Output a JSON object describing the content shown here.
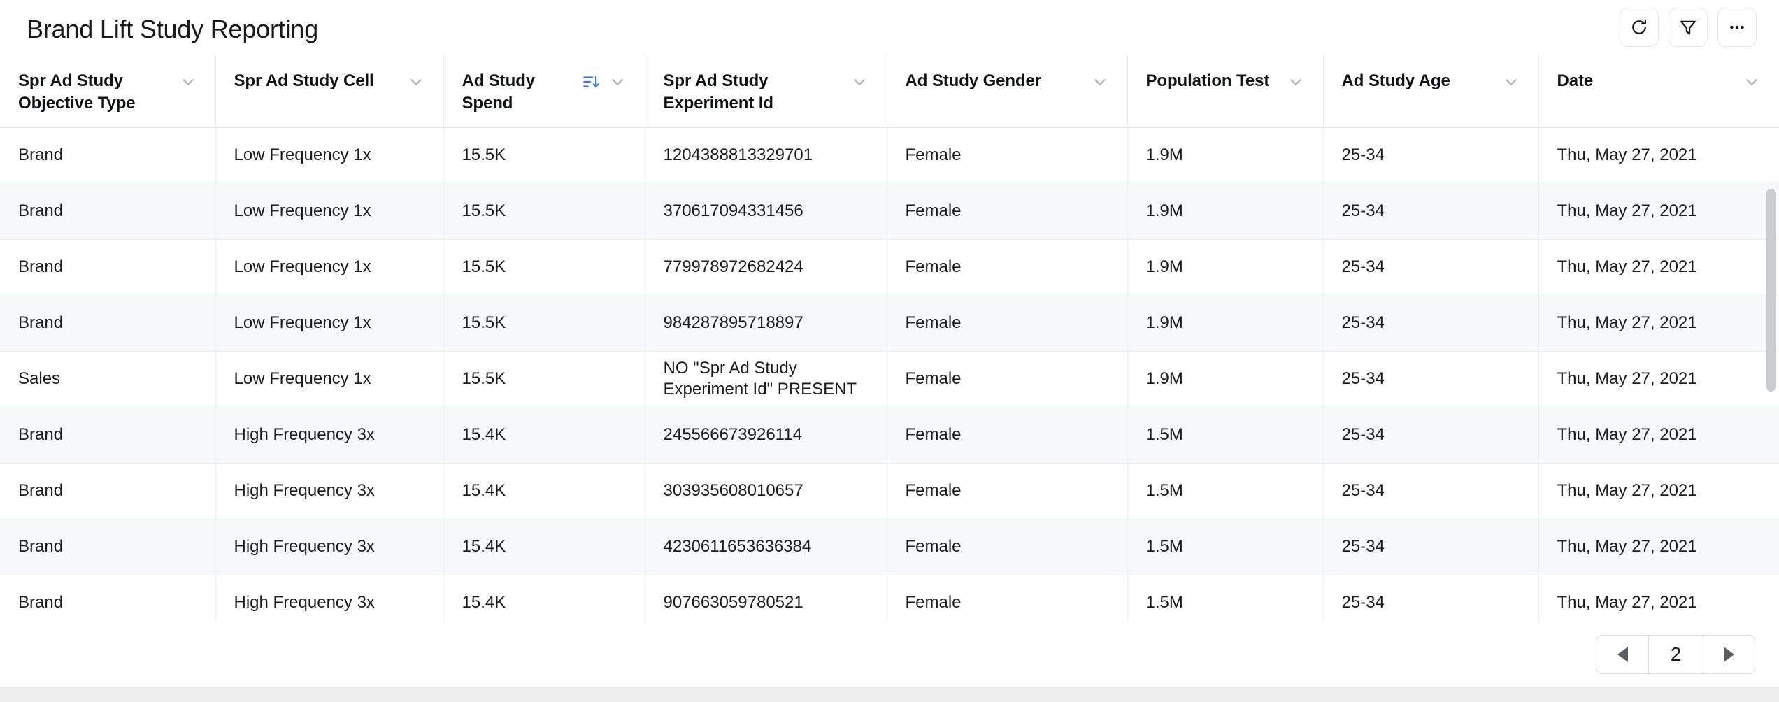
{
  "header": {
    "title": "Brand Lift Study Reporting",
    "actions": [
      {
        "name": "refresh-button",
        "icon": "refresh-icon",
        "label": "Refresh"
      },
      {
        "name": "filter-button",
        "icon": "filter-icon",
        "label": "Filter"
      },
      {
        "name": "more-options-button",
        "icon": "ellipsis-icon",
        "label": "More options"
      }
    ]
  },
  "table": {
    "columns": [
      {
        "label": "Spr Ad Study Objective Type",
        "sorted": false
      },
      {
        "label": "Spr Ad Study Cell",
        "sorted": false
      },
      {
        "label": "Ad Study Spend",
        "sorted": true,
        "sort_direction": "descending"
      },
      {
        "label": "Spr Ad Study Experiment Id",
        "sorted": false
      },
      {
        "label": "Ad Study Gender",
        "sorted": false
      },
      {
        "label": "Population Test",
        "sorted": false
      },
      {
        "label": "Ad Study Age",
        "sorted": false
      },
      {
        "label": "Date",
        "sorted": false
      }
    ],
    "rows": [
      [
        "Brand",
        "Low Frequency 1x",
        "15.5K",
        "1204388813329701",
        "Female",
        "1.9M",
        "25-34",
        "Thu, May 27, 2021"
      ],
      [
        "Brand",
        "Low Frequency 1x",
        "15.5K",
        "370617094331456",
        "Female",
        "1.9M",
        "25-34",
        "Thu, May 27, 2021"
      ],
      [
        "Brand",
        "Low Frequency 1x",
        "15.5K",
        "779978972682424",
        "Female",
        "1.9M",
        "25-34",
        "Thu, May 27, 2021"
      ],
      [
        "Brand",
        "Low Frequency 1x",
        "15.5K",
        "984287895718897",
        "Female",
        "1.9M",
        "25-34",
        "Thu, May 27, 2021"
      ],
      [
        "Sales",
        "Low Frequency 1x",
        "15.5K",
        "NO \"Spr Ad Study Experiment Id\" PRESENT",
        "Female",
        "1.9M",
        "25-34",
        "Thu, May 27, 2021"
      ],
      [
        "Brand",
        "High Frequency 3x",
        "15.4K",
        "245566673926114",
        "Female",
        "1.5M",
        "25-34",
        "Thu, May 27, 2021"
      ],
      [
        "Brand",
        "High Frequency 3x",
        "15.4K",
        "303935608010657",
        "Female",
        "1.5M",
        "25-34",
        "Thu, May 27, 2021"
      ],
      [
        "Brand",
        "High Frequency 3x",
        "15.4K",
        "4230611653636384",
        "Female",
        "1.5M",
        "25-34",
        "Thu, May 27, 2021"
      ],
      [
        "Brand",
        "High Frequency 3x",
        "15.4K",
        "907663059780521",
        "Female",
        "1.5M",
        "25-34",
        "Thu, May 27, 2021"
      ]
    ]
  },
  "pagination": {
    "previous_label": "Previous page",
    "next_label": "Next page",
    "current_page": "2"
  },
  "colors": {
    "sort_accent": "#3b76f0",
    "row_alt": "#f7f8fa",
    "border": "#e6e6e8",
    "text": "#1a1b1d"
  }
}
